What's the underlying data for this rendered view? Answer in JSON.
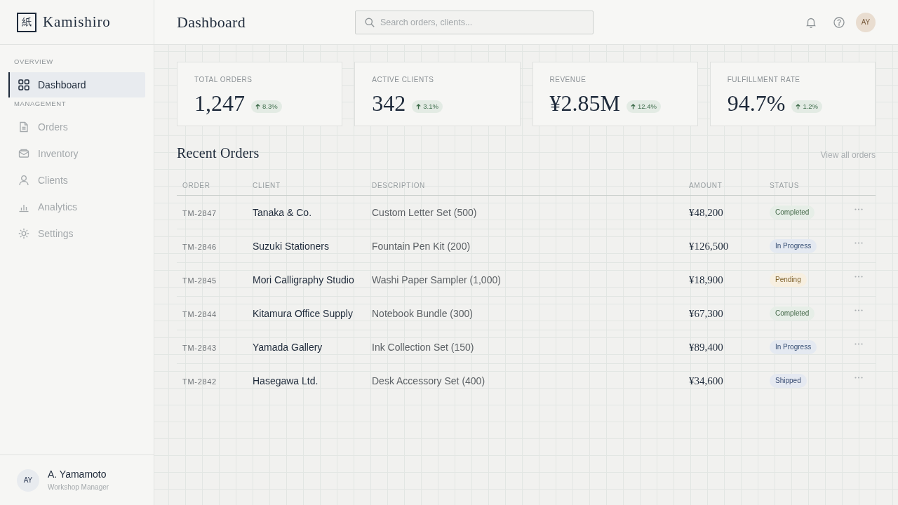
{
  "sidebar": {
    "logo": {
      "mark": "紙",
      "name": "Kamishiro"
    },
    "sections": [
      {
        "label": "OVERVIEW",
        "items": [
          {
            "label": "Dashboard",
            "selected": true
          }
        ]
      },
      {
        "label": "MANAGEMENT",
        "items": [
          {
            "label": "Orders",
            "selected": false
          },
          {
            "label": "Inventory",
            "selected": false
          },
          {
            "label": "Clients",
            "selected": false
          },
          {
            "label": "Analytics",
            "selected": false
          },
          {
            "label": "Settings",
            "selected": false
          }
        ]
      }
    ],
    "user": {
      "initials": "AY",
      "name": "A. Yamamoto",
      "role": "Workshop Manager"
    }
  },
  "header": {
    "title": "Dashboard",
    "search": {
      "placeholder": "Search orders, clients..."
    },
    "avatar_initials": "AY"
  },
  "stats": [
    {
      "label": "TOTAL ORDERS",
      "value": "1,247",
      "change": "8.3%"
    },
    {
      "label": "ACTIVE CLIENTS",
      "value": "342",
      "change": "3.1%"
    },
    {
      "label": "REVENUE",
      "value": "¥2.85M",
      "change": "12.4%"
    },
    {
      "label": "FULFILLMENT RATE",
      "value": "94.7%",
      "change": "1.2%"
    }
  ],
  "recent_orders": {
    "title": "Recent Orders",
    "link": "View all orders",
    "columns": [
      "ORDER",
      "CLIENT",
      "DESCRIPTION",
      "AMOUNT",
      "STATUS"
    ],
    "rows": [
      {
        "order": "TM-2847",
        "client": "Tanaka & Co.",
        "description": "Custom Letter Set (500)",
        "amount": "¥48,200",
        "status": {
          "label": "Completed",
          "color": "#e6eee7"
        }
      },
      {
        "order": "TM-2846",
        "client": "Suzuki Stationers",
        "description": "Fountain Pen Kit (200)",
        "amount": "¥126,500",
        "status": {
          "label": "In Progress",
          "color": "#e4e9f1"
        }
      },
      {
        "order": "TM-2845",
        "client": "Mori Calligraphy Studio",
        "description": "Washi Paper Sampler (1,000)",
        "amount": "¥18,900",
        "status": {
          "label": "Pending",
          "color": "#f7efe0"
        }
      },
      {
        "order": "TM-2844",
        "client": "Kitamura Office Supply",
        "description": "Notebook Bundle (300)",
        "amount": "¥67,300",
        "status": {
          "label": "Completed",
          "color": "#e6eee7"
        }
      },
      {
        "order": "TM-2843",
        "client": "Yamada Gallery",
        "description": "Ink Collection Set (150)",
        "amount": "¥89,400",
        "status": {
          "label": "In Progress",
          "color": "#e4e9f1"
        }
      },
      {
        "order": "TM-2842",
        "client": "Hasegawa Ltd.",
        "description": "Desk Accessory Set (400)",
        "amount": "¥34,600",
        "status": {
          "label": "Shipped",
          "color": "#e5e9f1"
        }
      }
    ]
  }
}
